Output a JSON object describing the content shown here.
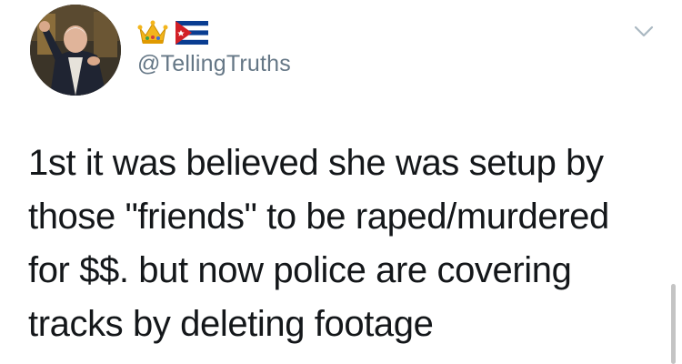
{
  "user": {
    "display_name_emojis": [
      "crown-emoji",
      "cuba-flag-emoji"
    ],
    "handle": "@TellingTruths"
  },
  "tweet": {
    "lines": [
      "1st it was believed she was setup by",
      "those \"friends\" to be raped/murdered",
      "for $$. but now police are covering",
      "tracks by deleting footage"
    ]
  },
  "icons": {
    "menu": "chevron-down-icon"
  },
  "colors": {
    "text": "#14171a",
    "handle": "#657786",
    "caret": "#aab8c2",
    "background": "#ffffff"
  }
}
